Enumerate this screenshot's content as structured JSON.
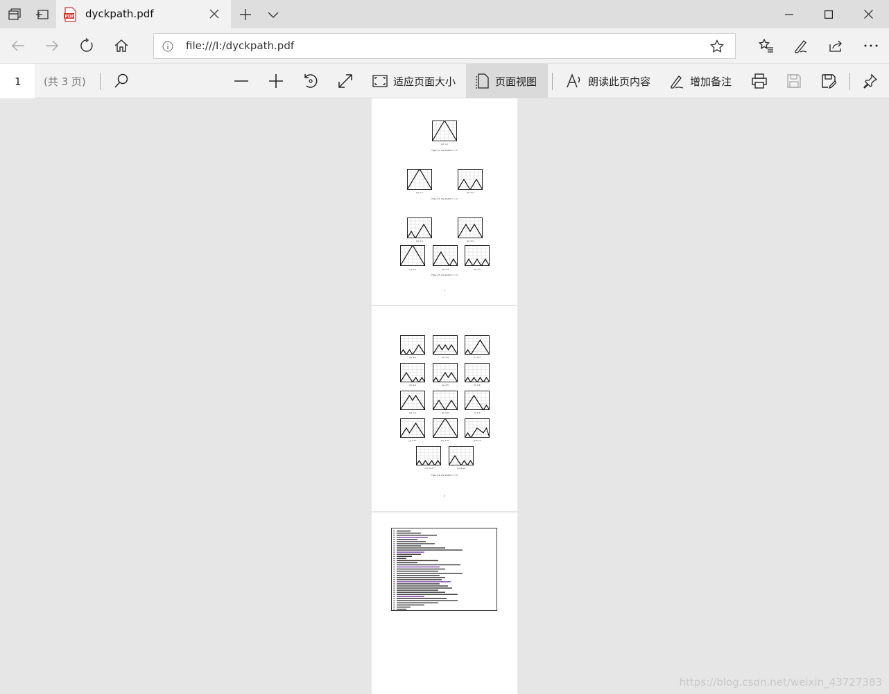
{
  "tab": {
    "title": "dyckpath.pdf"
  },
  "address": {
    "url": "file:///I:/dyckpath.pdf"
  },
  "pdf_toolbar": {
    "page_number": "1",
    "page_count": "(共 3 页)",
    "fit_page": "适应页面大小",
    "page_view": "页面视图",
    "read_aloud": "朗读此页内容",
    "add_notes": "增加备注"
  },
  "icons": [
    "tab-manager-icon",
    "set-aside-tabs-icon",
    "pdf-icon",
    "close-icon",
    "new-tab-icon",
    "chevron-down-icon",
    "minimize-icon",
    "maximize-icon",
    "back-icon",
    "forward-icon",
    "refresh-icon",
    "home-icon",
    "info-icon",
    "star-icon",
    "favorites-icon",
    "pen-icon",
    "share-icon",
    "more-icon",
    "search-icon",
    "zoom-out-icon",
    "zoom-in-icon",
    "rotate-icon",
    "fullscreen-icon",
    "fit-icon",
    "page-view-icon",
    "read-aloud-icon",
    "notes-icon",
    "print-icon",
    "save-icon",
    "save-as-icon",
    "pin-icon"
  ],
  "document": {
    "page1": {
      "captions_a": [
        "(a) 1-1"
      ],
      "figure1": "Figure 1: Dyckpath n = 1",
      "captions_b": [
        "(a) 2-1",
        "(b) 2-2"
      ],
      "figure2": "Figure 2: Dyckpath n = 2",
      "captions_c": [
        "(a) 3-1",
        "(b) 3-2",
        "(c) 3-3",
        "(d) 3-4",
        "(e) 3-5"
      ],
      "figure3": "Figure 3: Dyckpath n = 3",
      "page_no": "1"
    },
    "page2": {
      "captions": [
        "(a) 4-1",
        "(b) 4-2",
        "(c) 4-3",
        "(d) 4-4",
        "(e) 4-5",
        "(f) 4-6",
        "(g) 4-7",
        "(h) 4-8",
        "(i) 4-9",
        "(j) 4-10",
        "(k) 4-11",
        "(l) 4-12",
        "(m) 4-13",
        "(n) 4-14"
      ],
      "figure4": "Figure 4: Dyckpath n = 4",
      "page_no": "2"
    }
  },
  "watermark": "https://blog.csdn.net/weixin_43727383"
}
